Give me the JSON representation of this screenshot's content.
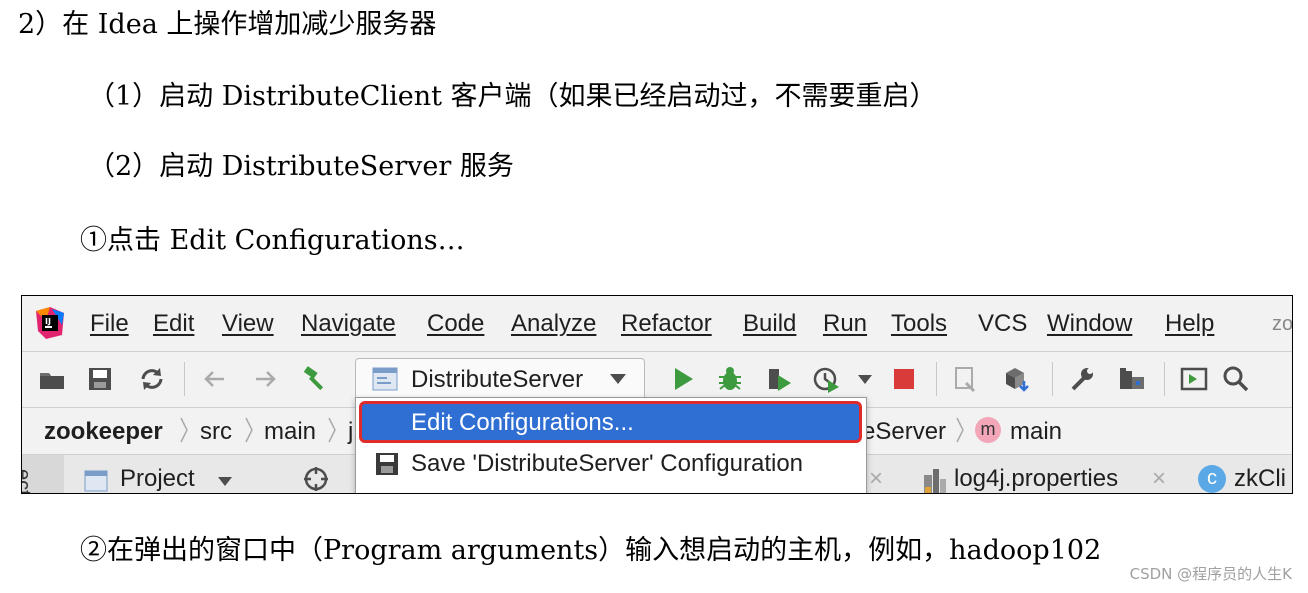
{
  "doc": {
    "line1": "2）在 Idea 上操作增加减少服务器",
    "line2": "（1）启动 DistributeClient 客户端（如果已经启动过，不需要重启）",
    "line3": "（2）启动 DistributeServer 服务",
    "line4": "①点击 Edit Configurations…",
    "line5": "②在弹出的窗口中（Program arguments）输入想启动的主机，例如，hadoop102",
    "watermark": "CSDN @程序员的人生K"
  },
  "ide": {
    "menu": [
      "File",
      "Edit",
      "View",
      "Navigate",
      "Code",
      "Analyze",
      "Refactor",
      "Build",
      "Run",
      "Tools",
      "VCS",
      "Window",
      "Help"
    ],
    "menu_overflow": "zo",
    "run_config": "DistributeServer",
    "breadcrumb": {
      "project": "zookeeper",
      "src": "src",
      "main": "main",
      "partial_pkg": "j",
      "partial_class": "eServer",
      "method": "main",
      "method_badge": "m"
    },
    "side_tool": "ect",
    "tabs": {
      "project": "Project",
      "log4j": "log4j.properties",
      "zkclient": "zkCli",
      "zk_badge": "c"
    },
    "popup": {
      "edit": "Edit Configurations...",
      "save": "Save 'DistributeServer' Configuration"
    }
  },
  "colors": {
    "highlight": "#2f6ed2",
    "annotation_border": "#e02b2b",
    "run_green": "#3e9a3e",
    "stop_red": "#d93b3b"
  }
}
